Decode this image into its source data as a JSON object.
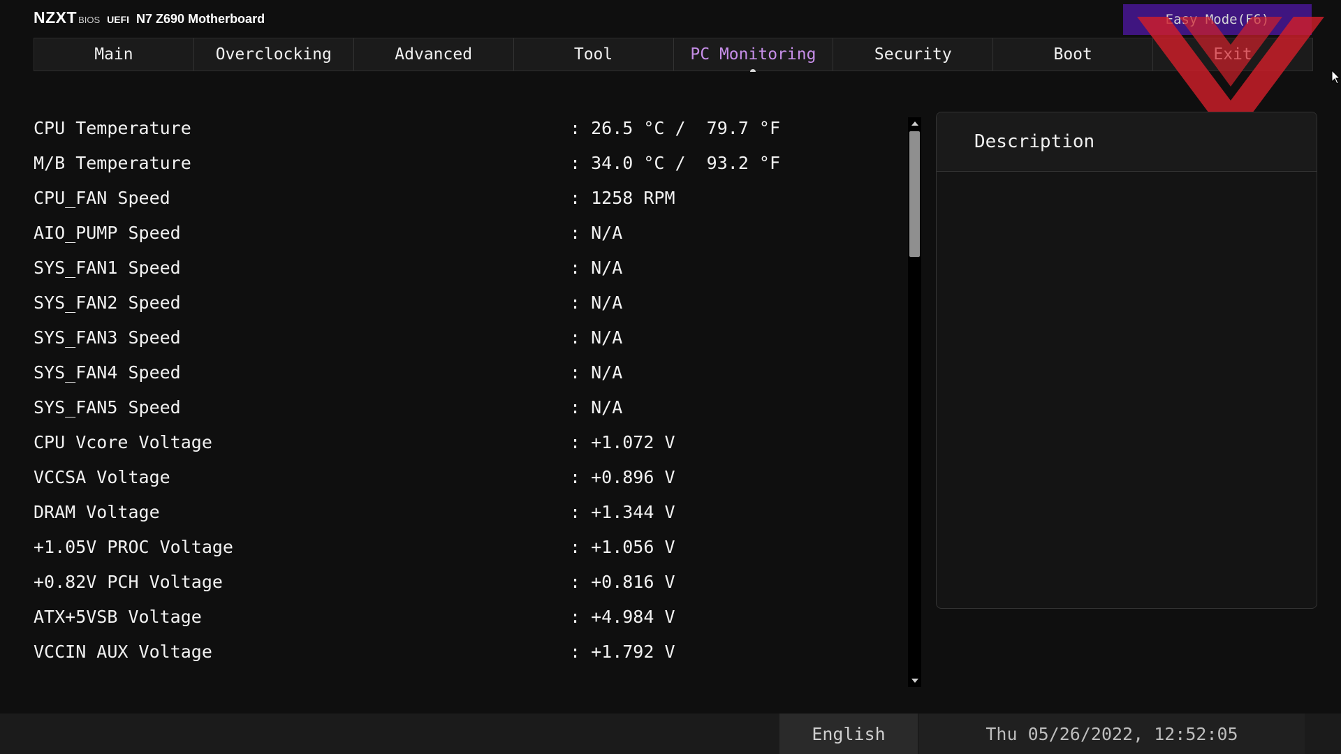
{
  "header": {
    "brand_logo": "NZXT",
    "brand_bios": "BIOS",
    "brand_uefi": "UEFI",
    "model": "N7 Z690 Motherboard",
    "easy_mode_label": "Easy Mode(F6)"
  },
  "tabs": [
    {
      "label": "Main"
    },
    {
      "label": "Overclocking"
    },
    {
      "label": "Advanced"
    },
    {
      "label": "Tool"
    },
    {
      "label": "PC Monitoring",
      "active": true
    },
    {
      "label": "Security"
    },
    {
      "label": "Boot"
    },
    {
      "label": "Exit"
    }
  ],
  "monitor": {
    "rows": [
      {
        "label": "CPU Temperature",
        "value": ": 26.5 °C /  79.7 °F"
      },
      {
        "label": "M/B Temperature",
        "value": ": 34.0 °C /  93.2 °F"
      },
      {
        "label": "CPU_FAN Speed",
        "value": ": 1258 RPM"
      },
      {
        "label": "AIO_PUMP Speed",
        "value": ": N/A"
      },
      {
        "label": "SYS_FAN1 Speed",
        "value": ": N/A"
      },
      {
        "label": "SYS_FAN2 Speed",
        "value": ": N/A"
      },
      {
        "label": "SYS_FAN3 Speed",
        "value": ": N/A"
      },
      {
        "label": "SYS_FAN4 Speed",
        "value": ": N/A"
      },
      {
        "label": "SYS_FAN5 Speed",
        "value": ": N/A"
      },
      {
        "label": "CPU Vcore Voltage",
        "value": ": +1.072 V"
      },
      {
        "label": "VCCSA Voltage",
        "value": ": +0.896 V"
      },
      {
        "label": "DRAM Voltage",
        "value": ": +1.344 V"
      },
      {
        "label": "+1.05V PROC Voltage",
        "value": ": +1.056 V"
      },
      {
        "label": "+0.82V PCH Voltage",
        "value": ": +0.816 V"
      },
      {
        "label": "ATX+5VSB Voltage",
        "value": ": +4.984 V"
      },
      {
        "label": "VCCIN AUX Voltage",
        "value": ": +1.792 V"
      }
    ]
  },
  "description": {
    "title": "Description"
  },
  "footer": {
    "language": "English",
    "datetime": "Thu 05/26/2022, 12:52:05"
  },
  "icons": {
    "scroll_up": "scroll-up-arrow-icon",
    "scroll_down": "scroll-down-arrow-icon",
    "watermark": "x-watermark-icon",
    "cursor": "mouse-cursor-icon"
  },
  "colors": {
    "background": "#0f0f0f",
    "active_tab": "#c68ee8",
    "easy_mode_bg": "#3f1580",
    "watermark": "#d01f2a"
  }
}
